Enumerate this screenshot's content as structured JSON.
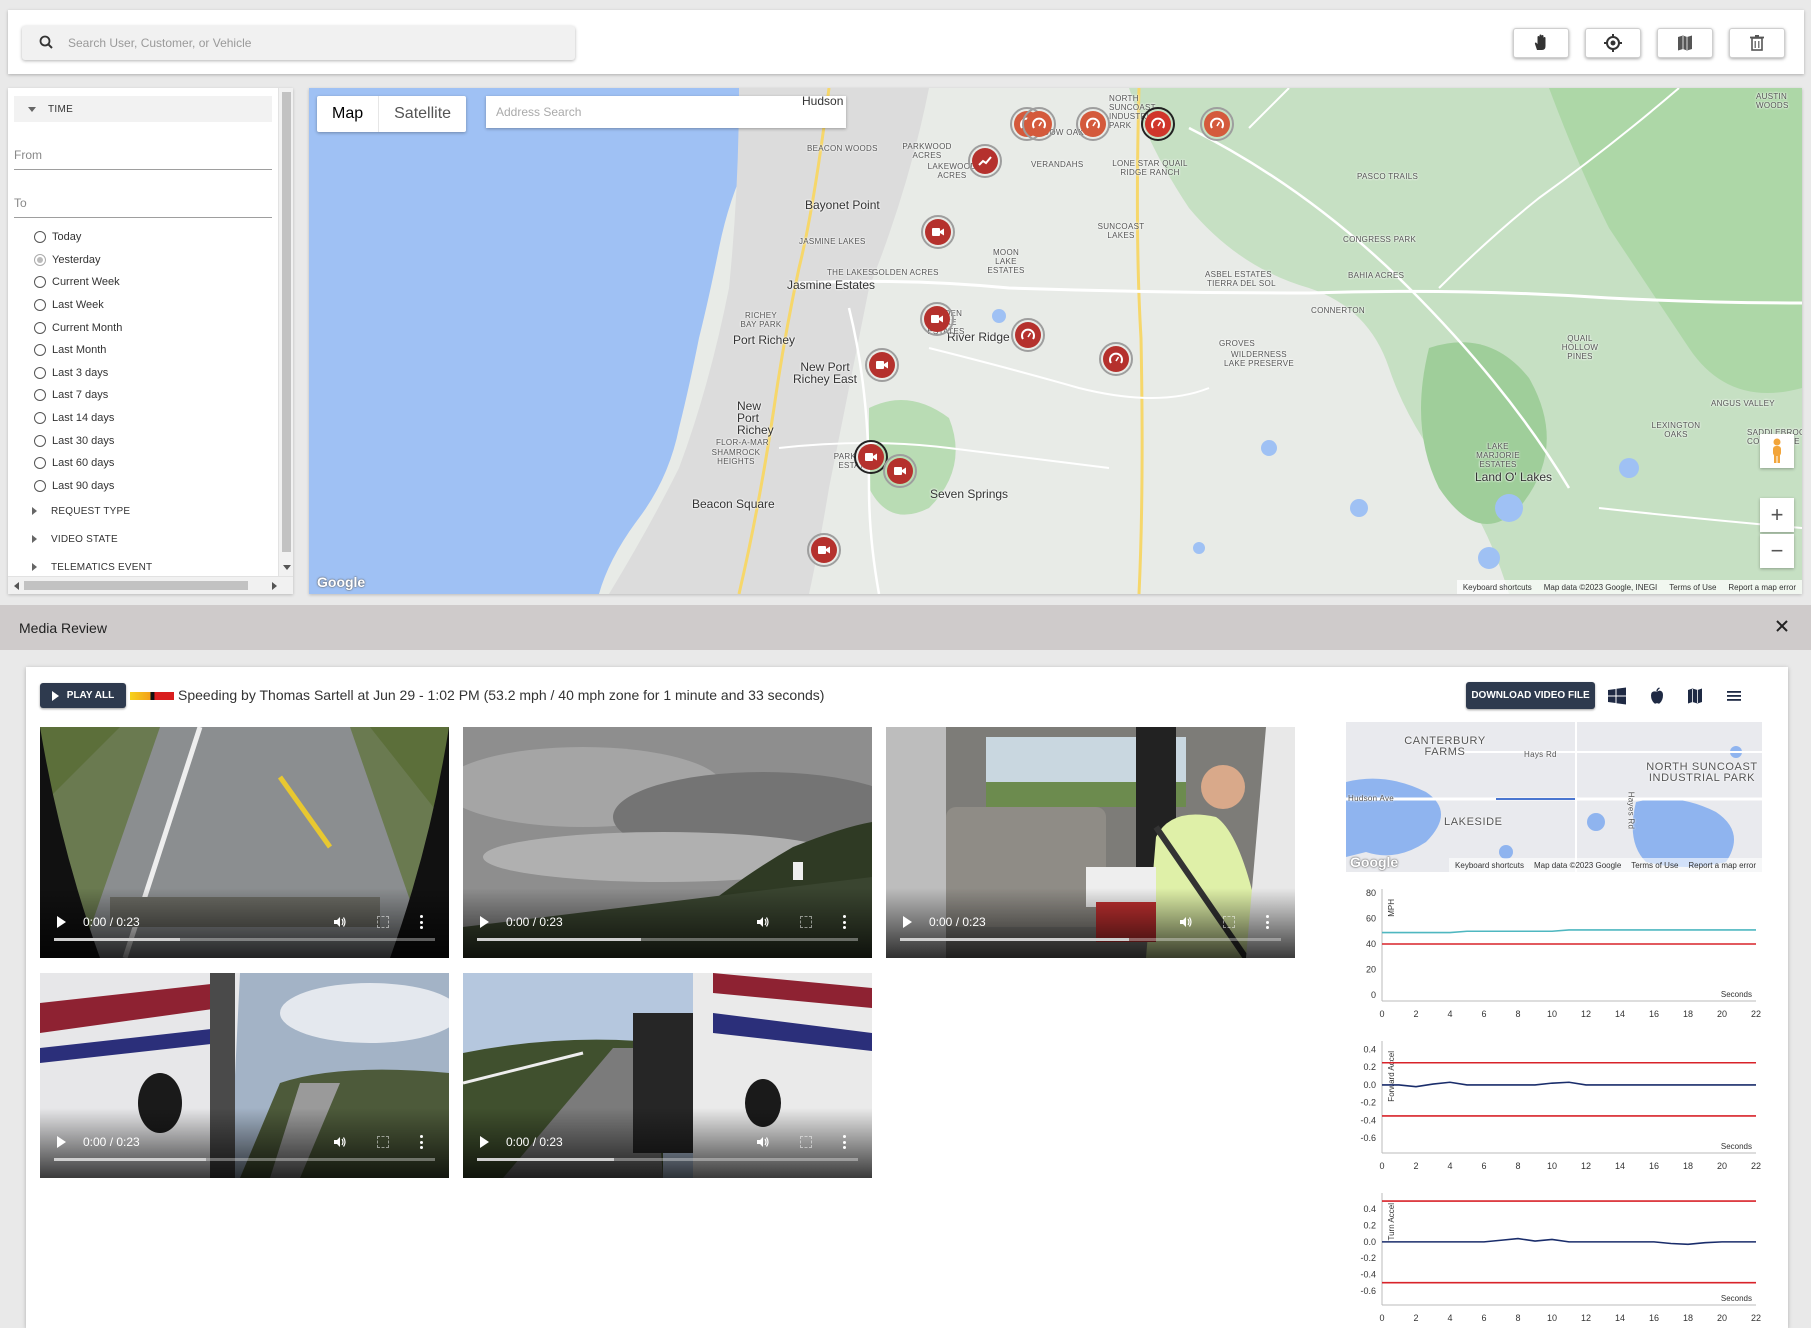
{
  "search": {
    "placeholder": "Search User, Customer, or Vehicle"
  },
  "toolbar": {
    "icons": [
      "hand-icon",
      "target-icon",
      "map-fold-icon",
      "trash-icon"
    ]
  },
  "filters": {
    "time_heading": "TIME",
    "from_label": "From",
    "to_label": "To",
    "ranges": [
      "Today",
      "Yesterday",
      "Current Week",
      "Last Week",
      "Current Month",
      "Last Month",
      "Last 3 days",
      "Last 7 days",
      "Last 14 days",
      "Last 30 days",
      "Last 60 days",
      "Last 90 days"
    ],
    "selected_range": "Yesterday",
    "collapsed_sections": [
      "REQUEST TYPE",
      "VIDEO STATE",
      "TELEMATICS EVENT"
    ]
  },
  "map": {
    "tabs": [
      "Map",
      "Satellite"
    ],
    "active_tab": "Map",
    "address_placeholder": "Address Search",
    "places": [
      "Hudson",
      "Bayonet Point",
      "Jasmine Estates",
      "Port Richey",
      "New Port Richey East",
      "New Port Richey",
      "River Ridge",
      "Land O' Lakes",
      "Seven Springs",
      "Beacon Square"
    ],
    "small_places": [
      "BEACON WOODS",
      "PARKWOOD ACRES",
      "LAKEWOOD ACRES",
      "MEADOW OAKS",
      "NORTH SUNCOAST INDUSTRIAL PARK",
      "VERANDAHS",
      "LONE STAR QUAIL RIDGE RANCH",
      "PASCO TRAILS",
      "AUSTIN WOODS",
      "JASMINE LAKES",
      "SUNCOAST LAKES",
      "CONGRESS PARK",
      "MOON LAKE ESTATES",
      "THE LAKES",
      "GOLDEN ACRES",
      "ASBEL ESTATES",
      "TIERRA DEL SOL",
      "BAHIA ACRES",
      "RICHEY BAY PARK",
      "HIDDEN LAKE ESTATES",
      "CONNERTON",
      "GROVES",
      "WILDERNESS LAKE PRESERVE",
      "QUAIL HOLLOW PINES",
      "FLOR-A-MAR",
      "SHAMROCK HEIGHTS",
      "PARK LAKE ESTATES",
      "LAKE MARJORIE ESTATES",
      "ANGUS VALLEY",
      "LEXINGTON OAKS",
      "SADDLEBROOK CORPORATE"
    ],
    "attribution": [
      "Keyboard shortcuts",
      "Map data ©2023 Google, INEGI",
      "Terms of Use",
      "Report a map error"
    ],
    "logo": "Google",
    "zoom_in": "+",
    "zoom_out": "−"
  },
  "media_review": {
    "title": "Media Review",
    "play_all": "PLAY ALL",
    "event_title": "Speeding by Thomas Sartell at Jun 29 - 1:02 PM (53.2 mph / 40 mph zone for 1 minute and 33 seconds)",
    "download": "DOWNLOAD VIDEO FILE",
    "icons": [
      "windows-icon",
      "apple-icon",
      "map-icon",
      "menu-icon"
    ],
    "videos": [
      {
        "time": "0:00 / 0:23",
        "progress": 0.33
      },
      {
        "time": "0:00 / 0:23",
        "progress": 0.43
      },
      {
        "time": "0:00 / 0:23",
        "progress": 0.6
      },
      {
        "time": "0:00 / 0:23",
        "progress": 0.4
      },
      {
        "time": "0:00 / 0:23",
        "progress": 0.36
      }
    ],
    "minimap": {
      "labels": [
        "CANTERBURY FARMS",
        "Hays Rd",
        "NORTH SUNCOAST INDUSTRIAL PARK",
        "Hudson Ave",
        "LAKESIDE",
        "Hayes Rd"
      ],
      "attribution": [
        "Keyboard shortcuts",
        "Map data ©2023 Google",
        "Terms of Use",
        "Report a map error"
      ],
      "logo": "Google"
    }
  },
  "chart_data": [
    {
      "type": "line",
      "ylabel": "MPH",
      "xlabel": "Seconds",
      "xlim": [
        0,
        22
      ],
      "ylim": [
        0,
        80
      ],
      "yticks": [
        0,
        20,
        40,
        60,
        80
      ],
      "xticks": [
        0,
        2,
        4,
        6,
        8,
        10,
        12,
        14,
        16,
        18,
        20,
        22
      ],
      "series": [
        {
          "color": "#4fb7c0",
          "x": [
            0,
            4,
            5,
            10,
            11,
            22
          ],
          "y": [
            49,
            49,
            50,
            50,
            51,
            51
          ]
        },
        {
          "color": "#d8232a",
          "x": [
            0,
            22
          ],
          "y": [
            40,
            40
          ]
        }
      ]
    },
    {
      "type": "line",
      "ylabel": "Forward Accel",
      "xlabel": "Seconds",
      "xlim": [
        0,
        22
      ],
      "ylim": [
        -0.7,
        0.45
      ],
      "yticks": [
        0.4,
        0.2,
        0.0,
        -0.2,
        -0.4,
        -0.6
      ],
      "xticks": [
        0,
        2,
        4,
        6,
        8,
        10,
        12,
        14,
        16,
        18,
        20,
        22
      ],
      "series": [
        {
          "color": "#1a2d6b",
          "x": [
            0,
            1,
            2,
            3,
            4,
            5,
            6,
            7,
            8,
            9,
            10,
            11,
            12,
            14,
            16,
            18,
            20,
            22
          ],
          "y": [
            0,
            0,
            -0.02,
            0.01,
            0.03,
            0,
            0,
            0,
            0,
            0,
            0.02,
            0.03,
            0,
            0,
            0,
            0,
            0,
            0
          ]
        },
        {
          "color": "#d8232a",
          "x": [
            0,
            22
          ],
          "y": [
            0.25,
            0.25
          ]
        },
        {
          "color": "#d8232a",
          "x": [
            0,
            22
          ],
          "y": [
            -0.35,
            -0.35
          ]
        }
      ]
    },
    {
      "type": "line",
      "ylabel": "Turn Accel",
      "xlabel": "Seconds",
      "xlim": [
        0,
        22
      ],
      "ylim": [
        -0.7,
        0.55
      ],
      "yticks": [
        0.4,
        0.2,
        0.0,
        -0.2,
        -0.4,
        -0.6
      ],
      "xticks": [
        0,
        2,
        4,
        6,
        8,
        10,
        12,
        14,
        16,
        18,
        20,
        22
      ],
      "series": [
        {
          "color": "#1a2d6b",
          "x": [
            0,
            6,
            7,
            8,
            9,
            10,
            11,
            12,
            16,
            17,
            18,
            19,
            20,
            22
          ],
          "y": [
            0,
            0,
            0.02,
            0.04,
            0.01,
            0.03,
            0,
            0,
            0,
            -0.02,
            -0.03,
            -0.01,
            0,
            0
          ]
        },
        {
          "color": "#d8232a",
          "x": [
            0,
            22
          ],
          "y": [
            0.5,
            0.5
          ]
        },
        {
          "color": "#d8232a",
          "x": [
            0,
            22
          ],
          "y": [
            -0.5,
            -0.5
          ]
        }
      ]
    }
  ]
}
